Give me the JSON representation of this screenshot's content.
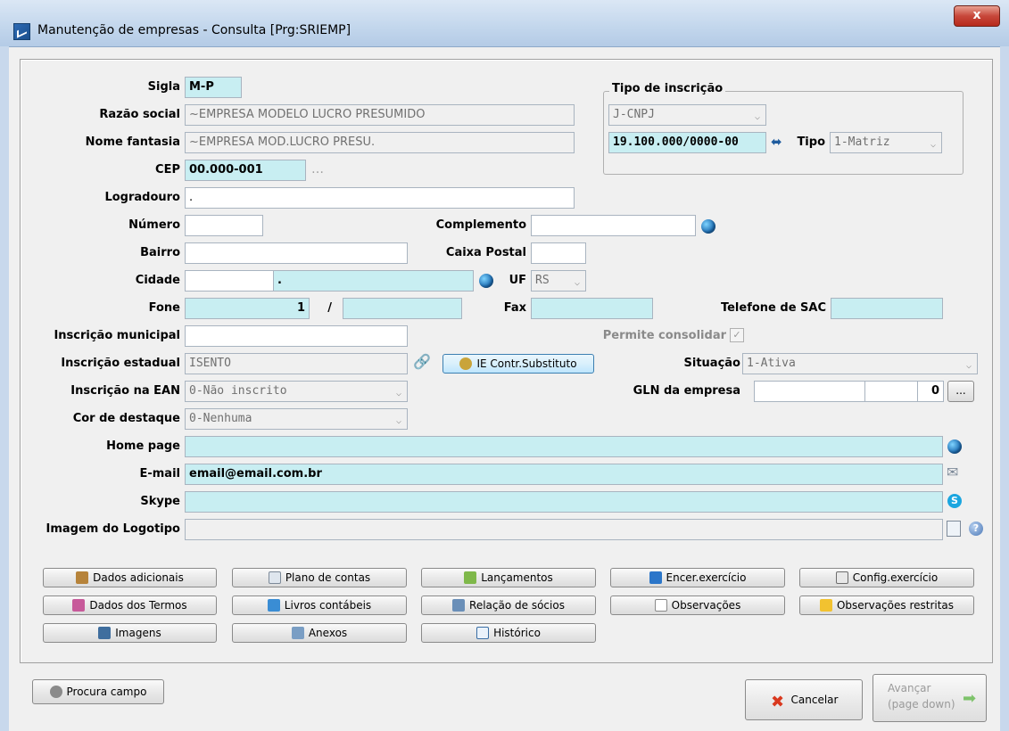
{
  "window": {
    "title": "Manutenção de empresas - Consulta [Prg:SRIEMP]",
    "close_label": "x"
  },
  "labels": {
    "sigla": "Sigla",
    "razao_social": "Razão social",
    "nome_fantasia": "Nome fantasia",
    "cep": "CEP",
    "logradouro": "Logradouro",
    "numero": "Número",
    "complemento": "Complemento",
    "bairro": "Bairro",
    "caixa_postal": "Caixa Postal",
    "cidade": "Cidade",
    "uf": "UF",
    "fone": "Fone",
    "fax": "Fax",
    "telefone_sac": "Telefone de SAC",
    "inscricao_municipal": "Inscrição municipal",
    "permite_consolidar": "Permite consolidar",
    "inscricao_estadual": "Inscrição estadual",
    "situacao": "Situação",
    "inscricao_ean": "Inscrição na EAN",
    "gln": "GLN da empresa",
    "cor_destaque": "Cor de destaque",
    "home_page": "Home page",
    "email": "E-mail",
    "skype": "Skype",
    "logotipo": "Imagem do Logotipo",
    "tipo_inscricao": "Tipo de inscrição",
    "tipo": "Tipo"
  },
  "values": {
    "sigla": "M-P",
    "razao_social": "~EMPRESA MODELO LUCRO PRESUMIDO",
    "nome_fantasia": "~EMPRESA MOD.LUCRO PRESU.",
    "cep": "00.000-001",
    "logradouro": ".",
    "numero": "",
    "complemento": "",
    "bairro": "",
    "caixa_postal": "",
    "cidade_codigo": "",
    "cidade_nome": ".",
    "uf": "RS",
    "fone_ddd": "1",
    "fone_sep": "/",
    "fone_numero": "",
    "fax": "",
    "telefone_sac": "",
    "inscricao_municipal": "",
    "inscricao_estadual": "ISENTO",
    "situacao": "1-Ativa",
    "inscricao_ean": "0-Não inscrito",
    "gln_1": "",
    "gln_2": "",
    "gln_digit": "0",
    "cor_destaque": "0-Nenhuma",
    "home_page": "",
    "email": "email@email.com.br",
    "skype": "",
    "logotipo": "",
    "tipo_inscricao_select": "J-CNPJ",
    "cnpj": "19.100.000/0000-00",
    "tipo": "1-Matriz",
    "permite_consolidar_checked": true
  },
  "buttons": {
    "ie_contr": "IE Contr.Substituto",
    "gln_more": "...",
    "dados_adicionais": "Dados adicionais",
    "plano_contas": "Plano de contas",
    "lancamentos": "Lançamentos",
    "encer_exercicio": "Encer.exercício",
    "config_exercicio": "Config.exercício",
    "dados_termos": "Dados dos Termos",
    "livros_contabeis": "Livros contábeis",
    "relacao_socios": "Relação de sócios",
    "observacoes": "Observações",
    "observacoes_restritas": "Observações restritas",
    "imagens": "Imagens",
    "anexos": "Anexos",
    "historico": "Histórico",
    "procura_campo": "Procura campo",
    "cancelar": "Cancelar",
    "avancar": "Avançar",
    "avancar_sub": "(page down)"
  },
  "colors": {
    "field_highlight": "#c8eef2",
    "titlebar": "#c2d6ec",
    "close": "#c7473a"
  }
}
